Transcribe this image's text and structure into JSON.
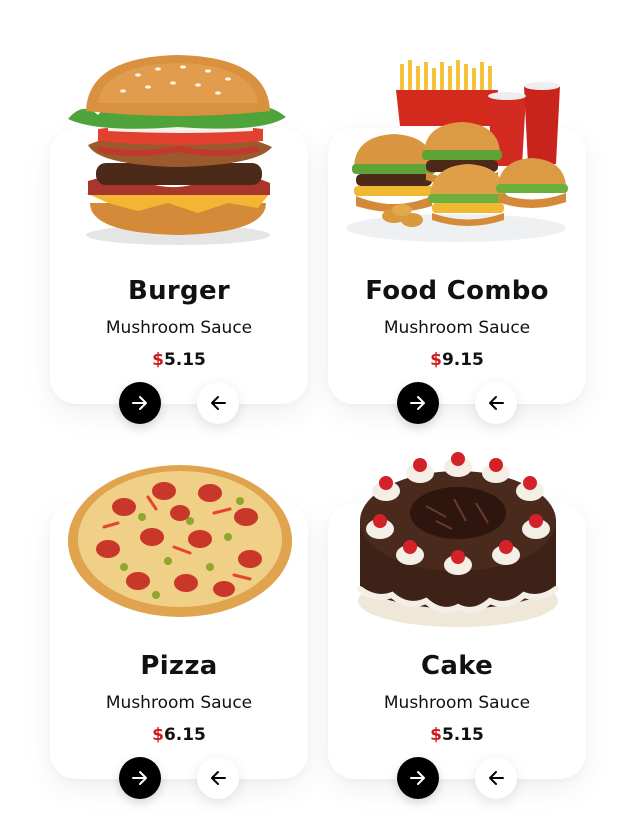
{
  "cards": [
    {
      "title": "Burger",
      "subtitle": "Mushroom Sauce",
      "currency": "$",
      "price": "5.15",
      "image": "burger-image"
    },
    {
      "title": "Food Combo",
      "subtitle": "Mushroom Sauce",
      "currency": "$",
      "price": "9.15",
      "image": "food-combo-image"
    },
    {
      "title": "Pizza",
      "subtitle": "Mushroom Sauce",
      "currency": "$",
      "price": "6.15",
      "image": "pizza-image"
    },
    {
      "title": "Cake",
      "subtitle": "Mushroom Sauce",
      "currency": "$",
      "price": "5.15",
      "image": "cake-image"
    }
  ],
  "buttons": {
    "next_icon": "arrow-right-icon",
    "back_icon": "arrow-left-icon"
  },
  "colors": {
    "accent": "#d01a1a",
    "button_dark": "#000000",
    "card_bg": "#ffffff"
  }
}
